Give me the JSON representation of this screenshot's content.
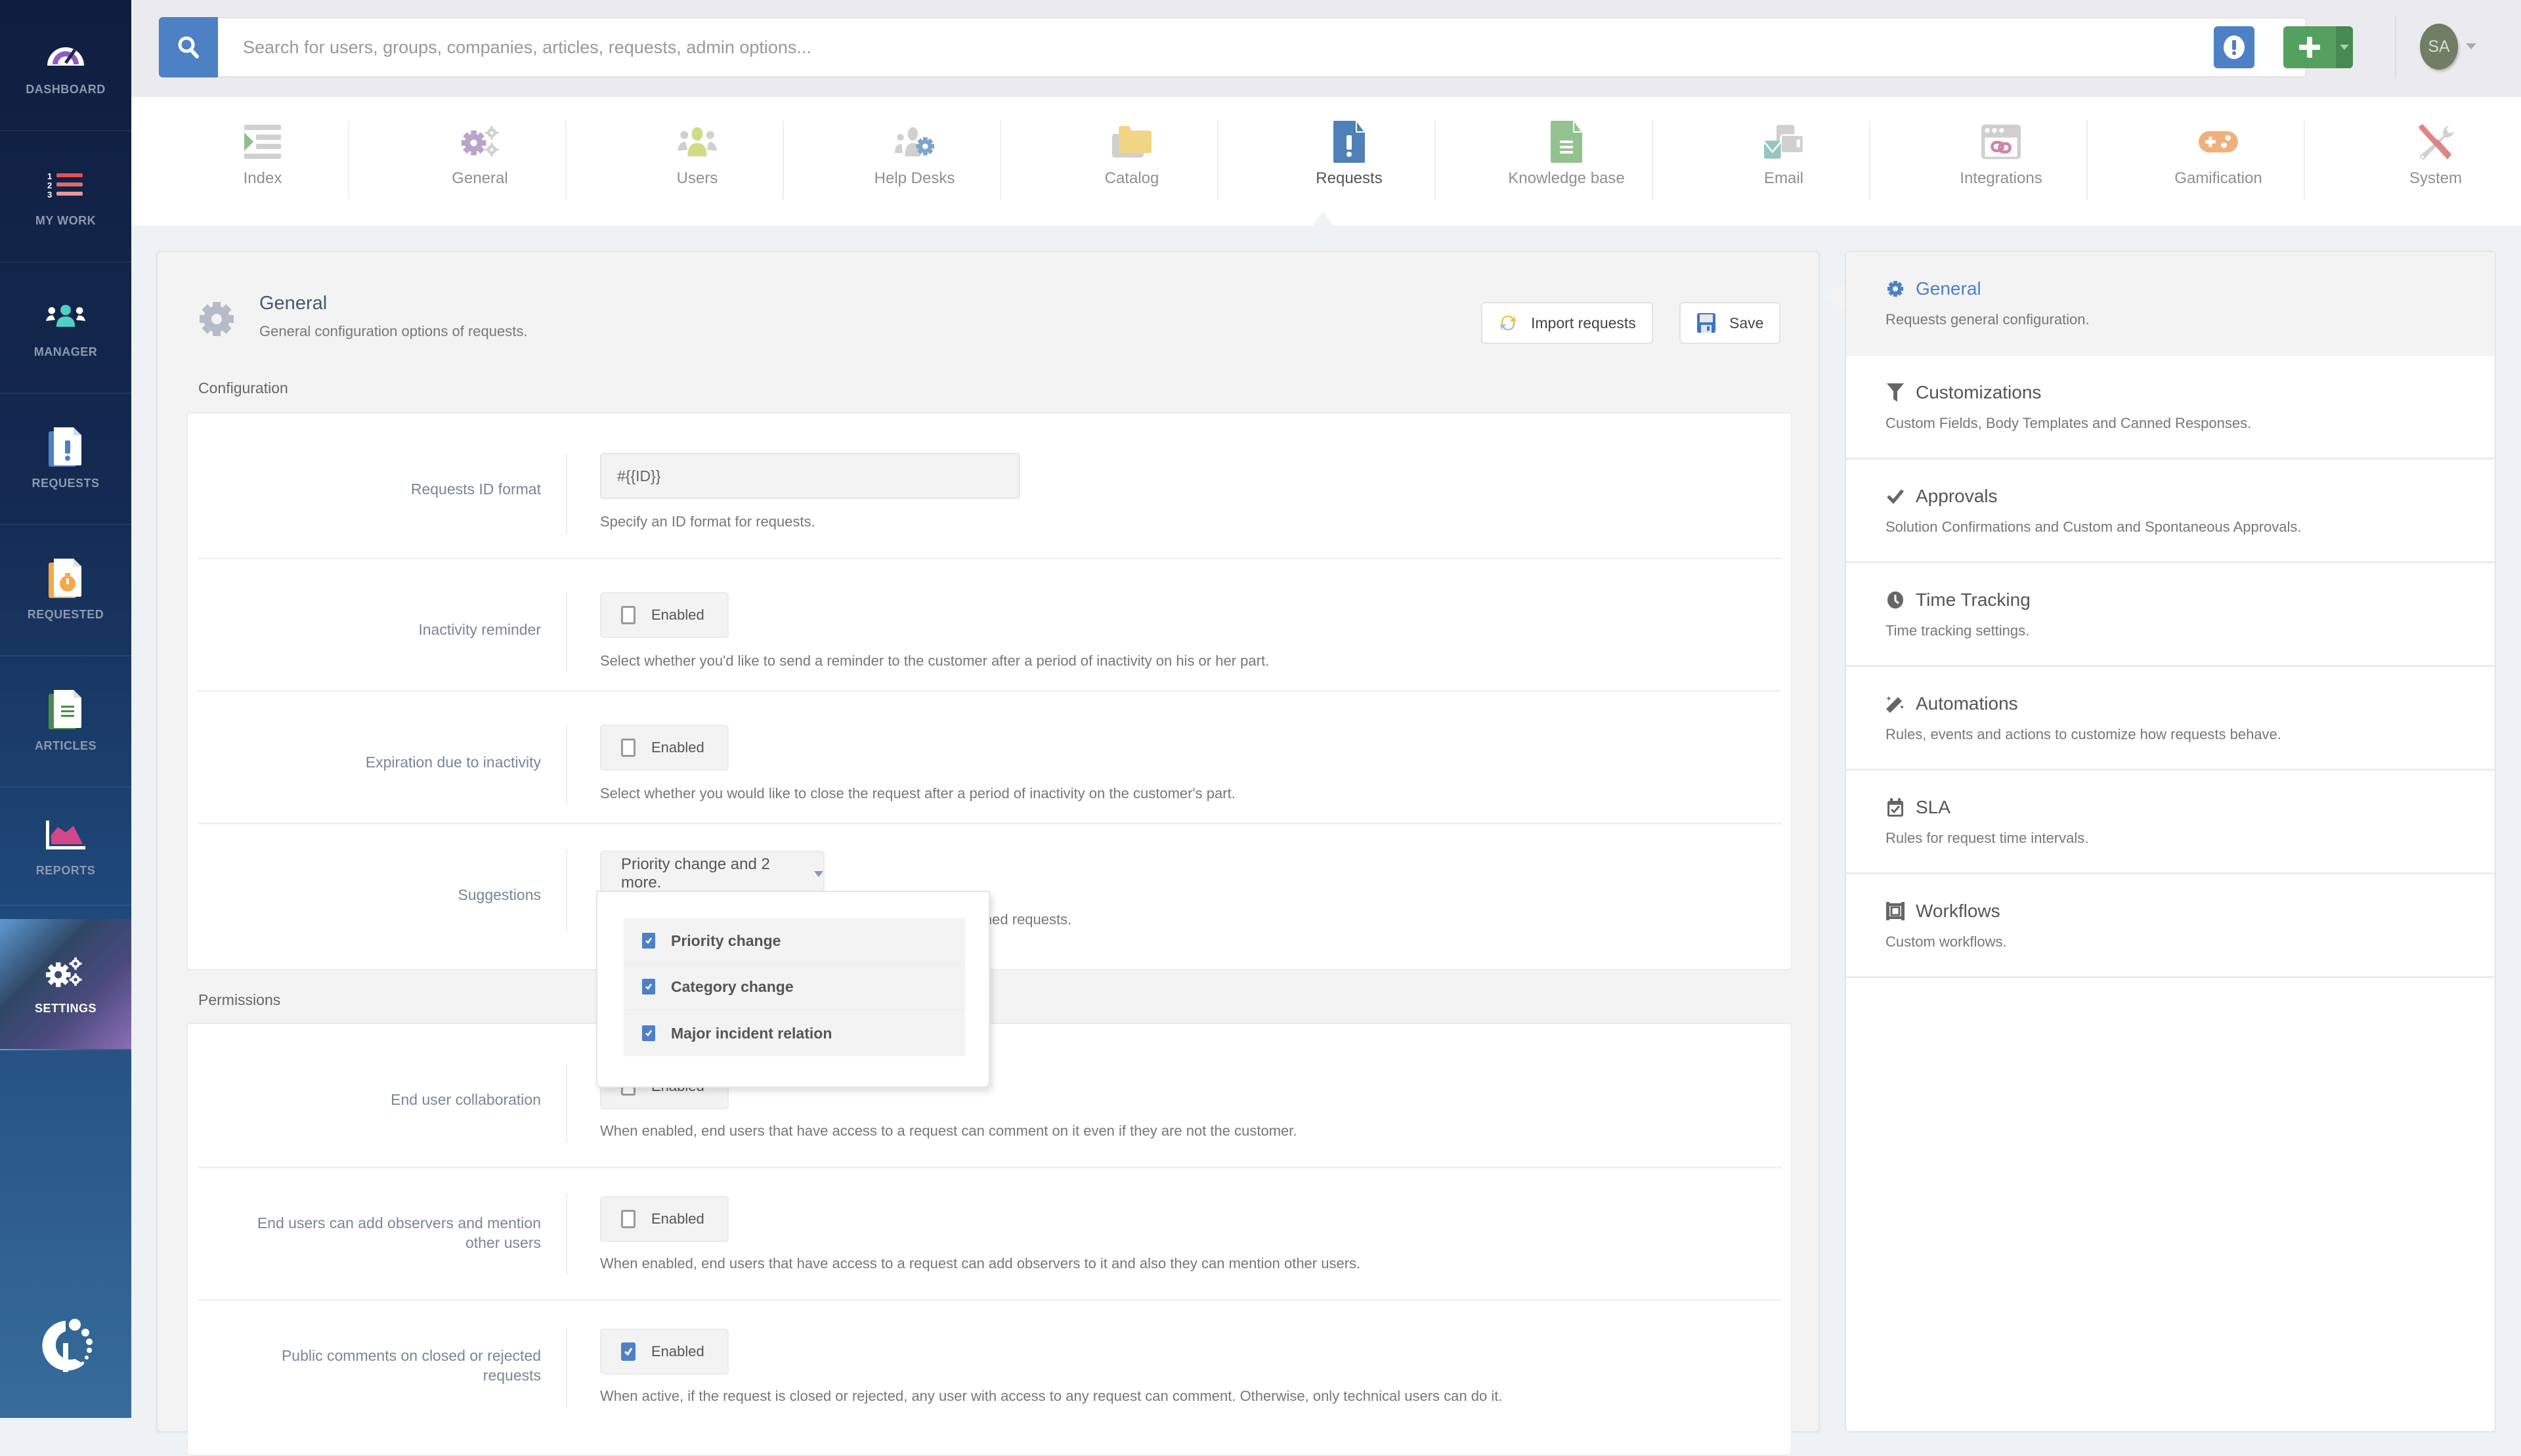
{
  "sidebar": {
    "items": [
      {
        "label": "DASHBOARD",
        "icon": "dashboard-gauge-icon"
      },
      {
        "label": "MY WORK",
        "icon": "numbered-list-icon"
      },
      {
        "label": "MANAGER",
        "icon": "users-group-icon"
      },
      {
        "label": "REQUESTS",
        "icon": "request-document-icon"
      },
      {
        "label": "REQUESTED",
        "icon": "stopwatch-document-icon"
      },
      {
        "label": "ARTICLES",
        "icon": "article-document-icon"
      },
      {
        "label": "REPORTS",
        "icon": "area-chart-icon"
      },
      {
        "label": "SETTINGS",
        "icon": "gears-icon",
        "active": true
      }
    ],
    "logo": "invgate-logo"
  },
  "topbar": {
    "search_placeholder": "Search for users, groups, companies, articles, requests, admin options...",
    "avatar_initials": "SA"
  },
  "modules": [
    {
      "label": "Index"
    },
    {
      "label": "General"
    },
    {
      "label": "Users"
    },
    {
      "label": "Help Desks"
    },
    {
      "label": "Catalog"
    },
    {
      "label": "Requests",
      "active": true
    },
    {
      "label": "Knowledge base"
    },
    {
      "label": "Email"
    },
    {
      "label": "Integrations"
    },
    {
      "label": "Gamification"
    },
    {
      "label": "System"
    }
  ],
  "page": {
    "title": "General",
    "subtitle": "General configuration options of requests.",
    "import_label": "Import requests",
    "save_label": "Save"
  },
  "configuration": {
    "title": "Configuration",
    "id_format": {
      "label": "Requests ID format",
      "value": "#{{ID}}",
      "desc": "Specify an ID format for requests."
    },
    "inactivity_reminder": {
      "label": "Inactivity reminder",
      "checkbox": "Enabled",
      "checked": false,
      "desc": "Select whether you'd like to send a reminder to the customer after a period of inactivity on his or her part."
    },
    "expiration": {
      "label": "Expiration due to inactivity",
      "checkbox": "Enabled",
      "checked": false,
      "desc": "Select whether you would like to close the request after a period of inactivity on the customer's part."
    },
    "suggestions": {
      "label": "Suggestions",
      "selected": "Priority change and 2 more.",
      "desc_visible": "eir assigned requests.",
      "options": [
        {
          "label": "Priority change",
          "checked": true
        },
        {
          "label": "Category change",
          "checked": true
        },
        {
          "label": "Major incident relation",
          "checked": true
        }
      ]
    }
  },
  "permissions": {
    "title": "Permissions",
    "end_user_collaboration": {
      "label": "End user collaboration",
      "checkbox": "Enabled",
      "checked": false,
      "desc": "When enabled, end users that have access to a request can comment on it even if they are not the customer."
    },
    "observers": {
      "label_line1": "End users can add observers and mention",
      "label_line2": "other users",
      "checkbox": "Enabled",
      "checked": false,
      "desc": "When enabled, end users that have access to a request can add observers to it and also they can mention other users."
    },
    "public_comments": {
      "label_line1": "Public comments on closed or rejected",
      "label_line2": "requests",
      "checkbox": "Enabled",
      "checked": true,
      "desc": "When active, if the request is closed or rejected, any user with access to any request can comment. Otherwise, only technical users can do it."
    }
  },
  "right_nav": [
    {
      "title": "General",
      "desc": "Requests general configuration.",
      "icon": "gear-icon",
      "active": true
    },
    {
      "title": "Customizations",
      "desc": "Custom Fields, Body Templates and Canned Responses.",
      "icon": "filter-icon"
    },
    {
      "title": "Approvals",
      "desc": "Solution Confirmations and Custom and Spontaneous Approvals.",
      "icon": "check-icon"
    },
    {
      "title": "Time Tracking",
      "desc": "Time tracking settings.",
      "icon": "clock-icon"
    },
    {
      "title": "Automations",
      "desc": "Rules, events and actions to customize how requests behave.",
      "icon": "magic-wand-icon"
    },
    {
      "title": "SLA",
      "desc": "Rules for request time intervals.",
      "icon": "calendar-check-icon"
    },
    {
      "title": "Workflows",
      "desc": "Custom workflows.",
      "icon": "workflow-icon"
    }
  ],
  "colors": {
    "accent": "#4d80c5",
    "add_green": "#55a05f",
    "sidebar_dark": "#0f1e3f"
  }
}
